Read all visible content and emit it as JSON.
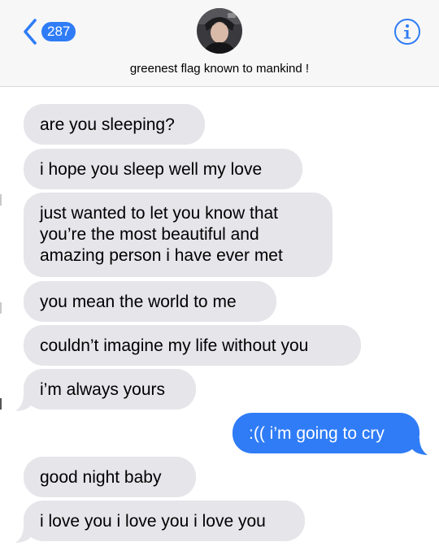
{
  "header": {
    "unread_count": "287",
    "contact_name": "greenest flag known to mankind !",
    "back_icon": "chevron-left-icon",
    "info_icon": "info-icon"
  },
  "colors": {
    "incoming_bubble": "#e5e5ea",
    "outgoing_bubble": "#2f7cf6",
    "header_bg": "#f7f7f7",
    "accent": "#2f7cf6"
  },
  "messages": [
    {
      "direction": "incoming",
      "text": "are you sleeping?"
    },
    {
      "direction": "incoming",
      "text": "i hope you sleep well my love"
    },
    {
      "direction": "incoming",
      "text": "just wanted to let you know that\nyou’re the most beautiful and\namazing person i have ever met"
    },
    {
      "direction": "incoming",
      "text": "you mean the world to me"
    },
    {
      "direction": "incoming",
      "text": "couldn’t imagine my life without you"
    },
    {
      "direction": "incoming",
      "text": "i’m always yours"
    },
    {
      "direction": "outgoing",
      "text": ":(( i’m going to cry"
    },
    {
      "direction": "incoming",
      "text": "good night baby"
    },
    {
      "direction": "incoming",
      "text": "i love you i love you i love you"
    }
  ]
}
